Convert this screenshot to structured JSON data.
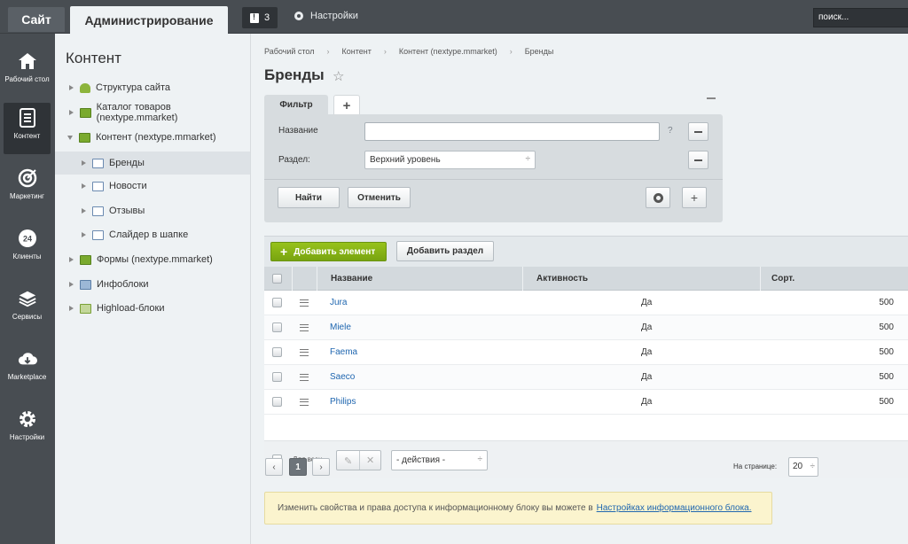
{
  "topbar": {
    "site_tab": "Сайт",
    "admin_tab": "Администрирование",
    "notifications_count": "3",
    "settings_label": "Настройки",
    "search_placeholder": "поиск..."
  },
  "iconbar": [
    {
      "icon": "home-icon",
      "label": "Рабочий стол"
    },
    {
      "icon": "document-icon",
      "label": "Контент",
      "active": true
    },
    {
      "icon": "target-icon",
      "label": "Маркетинг"
    },
    {
      "icon": "clock-24-icon",
      "label": "Клиенты"
    },
    {
      "icon": "layers-icon",
      "label": "Сервисы"
    },
    {
      "icon": "cloud-download-icon",
      "label": "Marketplace"
    },
    {
      "icon": "gear-icon",
      "label": "Настройки"
    }
  ],
  "tree": {
    "title": "Контент",
    "items": [
      {
        "label": "Структура сайта",
        "level": 0,
        "expanded": false
      },
      {
        "label": "Каталог товаров (nextype.mmarket)",
        "level": 0,
        "expanded": false
      },
      {
        "label": "Контент (nextype.mmarket)",
        "level": 0,
        "expanded": true
      },
      {
        "label": "Бренды",
        "level": 1,
        "selected": true
      },
      {
        "label": "Новости",
        "level": 1
      },
      {
        "label": "Отзывы",
        "level": 1
      },
      {
        "label": "Слайдер в шапке",
        "level": 1
      },
      {
        "label": "Формы (nextype.mmarket)",
        "level": 0
      },
      {
        "label": "Инфоблоки",
        "level": 0
      },
      {
        "label": "Highload-блоки",
        "level": 0
      }
    ]
  },
  "breadcrumbs": [
    "Рабочий стол",
    "Контент",
    "Контент (nextype.mmarket)",
    "Бренды"
  ],
  "page_title": "Бренды",
  "filter": {
    "tab_label": "Фильтр",
    "add_tab": "+",
    "name_label": "Название",
    "name_value": "",
    "help": "?",
    "section_label": "Раздел:",
    "section_value": "Верхний уровень",
    "find_button": "Найти",
    "cancel_button": "Отменить",
    "plus_button": "+"
  },
  "grid": {
    "add_element": "Добавить элемент",
    "add_section": "Добавить раздел",
    "columns": {
      "name": "Название",
      "activity": "Активность",
      "sort": "Сорт."
    },
    "rows": [
      {
        "name": "Jura",
        "activity": "Да",
        "sort": "500"
      },
      {
        "name": "Miele",
        "activity": "Да",
        "sort": "500"
      },
      {
        "name": "Faema",
        "activity": "Да",
        "sort": "500"
      },
      {
        "name": "Saeco",
        "activity": "Да",
        "sort": "500"
      },
      {
        "name": "Philips",
        "activity": "Да",
        "sort": "500"
      }
    ],
    "for_all": "Для всех",
    "actions_select": "- действия -"
  },
  "pager": {
    "prev": "‹",
    "current": "1",
    "next": "›",
    "per_page_label": "На странице:",
    "per_page_value": "20"
  },
  "notice": {
    "text": "Изменить свойства и права доступа к информационному блоку вы можете в",
    "link": "Настройках информационного блока."
  }
}
